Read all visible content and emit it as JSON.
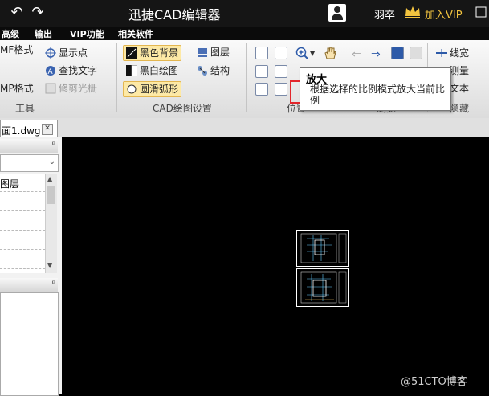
{
  "app": {
    "title": "迅捷CAD编辑器",
    "username": "羽卒",
    "vip_label": "加入VIP",
    "vip_color": "#f3c43f"
  },
  "quick_access": {
    "undo_icon": "undo-arrow-icon",
    "redo_icon": "redo-arrow-icon"
  },
  "menu": [
    "高级",
    "输出",
    "VIP功能",
    "相关软件"
  ],
  "ribbon": {
    "tools": {
      "items": [
        "MF格式",
        "MP格式"
      ],
      "cmds": [
        "显示点",
        "查找文字",
        "修剪光栅"
      ],
      "label": "工具"
    },
    "cad_settings": {
      "black_bg": "黑色背景",
      "bw_draw": "黑白绘图",
      "smooth_arc": "圆滑弧形",
      "layers": "图层",
      "structure": "结构",
      "label": "CAD绘图设置"
    },
    "position": {
      "label": "位置"
    },
    "browse": {
      "label": "浏览"
    },
    "hidden": {
      "linewidth": "线宽",
      "measure": "测量",
      "text": "文本",
      "label": "隐藏"
    }
  },
  "tooltip": {
    "title": "放大",
    "desc": "根据选择的比例模式放大当前比例"
  },
  "tabs": [
    {
      "label": "面1.dwg"
    }
  ],
  "left_panel": {
    "pin": "ᵖ",
    "rows": [
      "图层",
      "",
      "",
      ""
    ]
  },
  "watermark": "@51CTO博客",
  "colors": {
    "highlight": "#fde9a6",
    "red_box": "#e3262c",
    "canvas": "#000000"
  }
}
